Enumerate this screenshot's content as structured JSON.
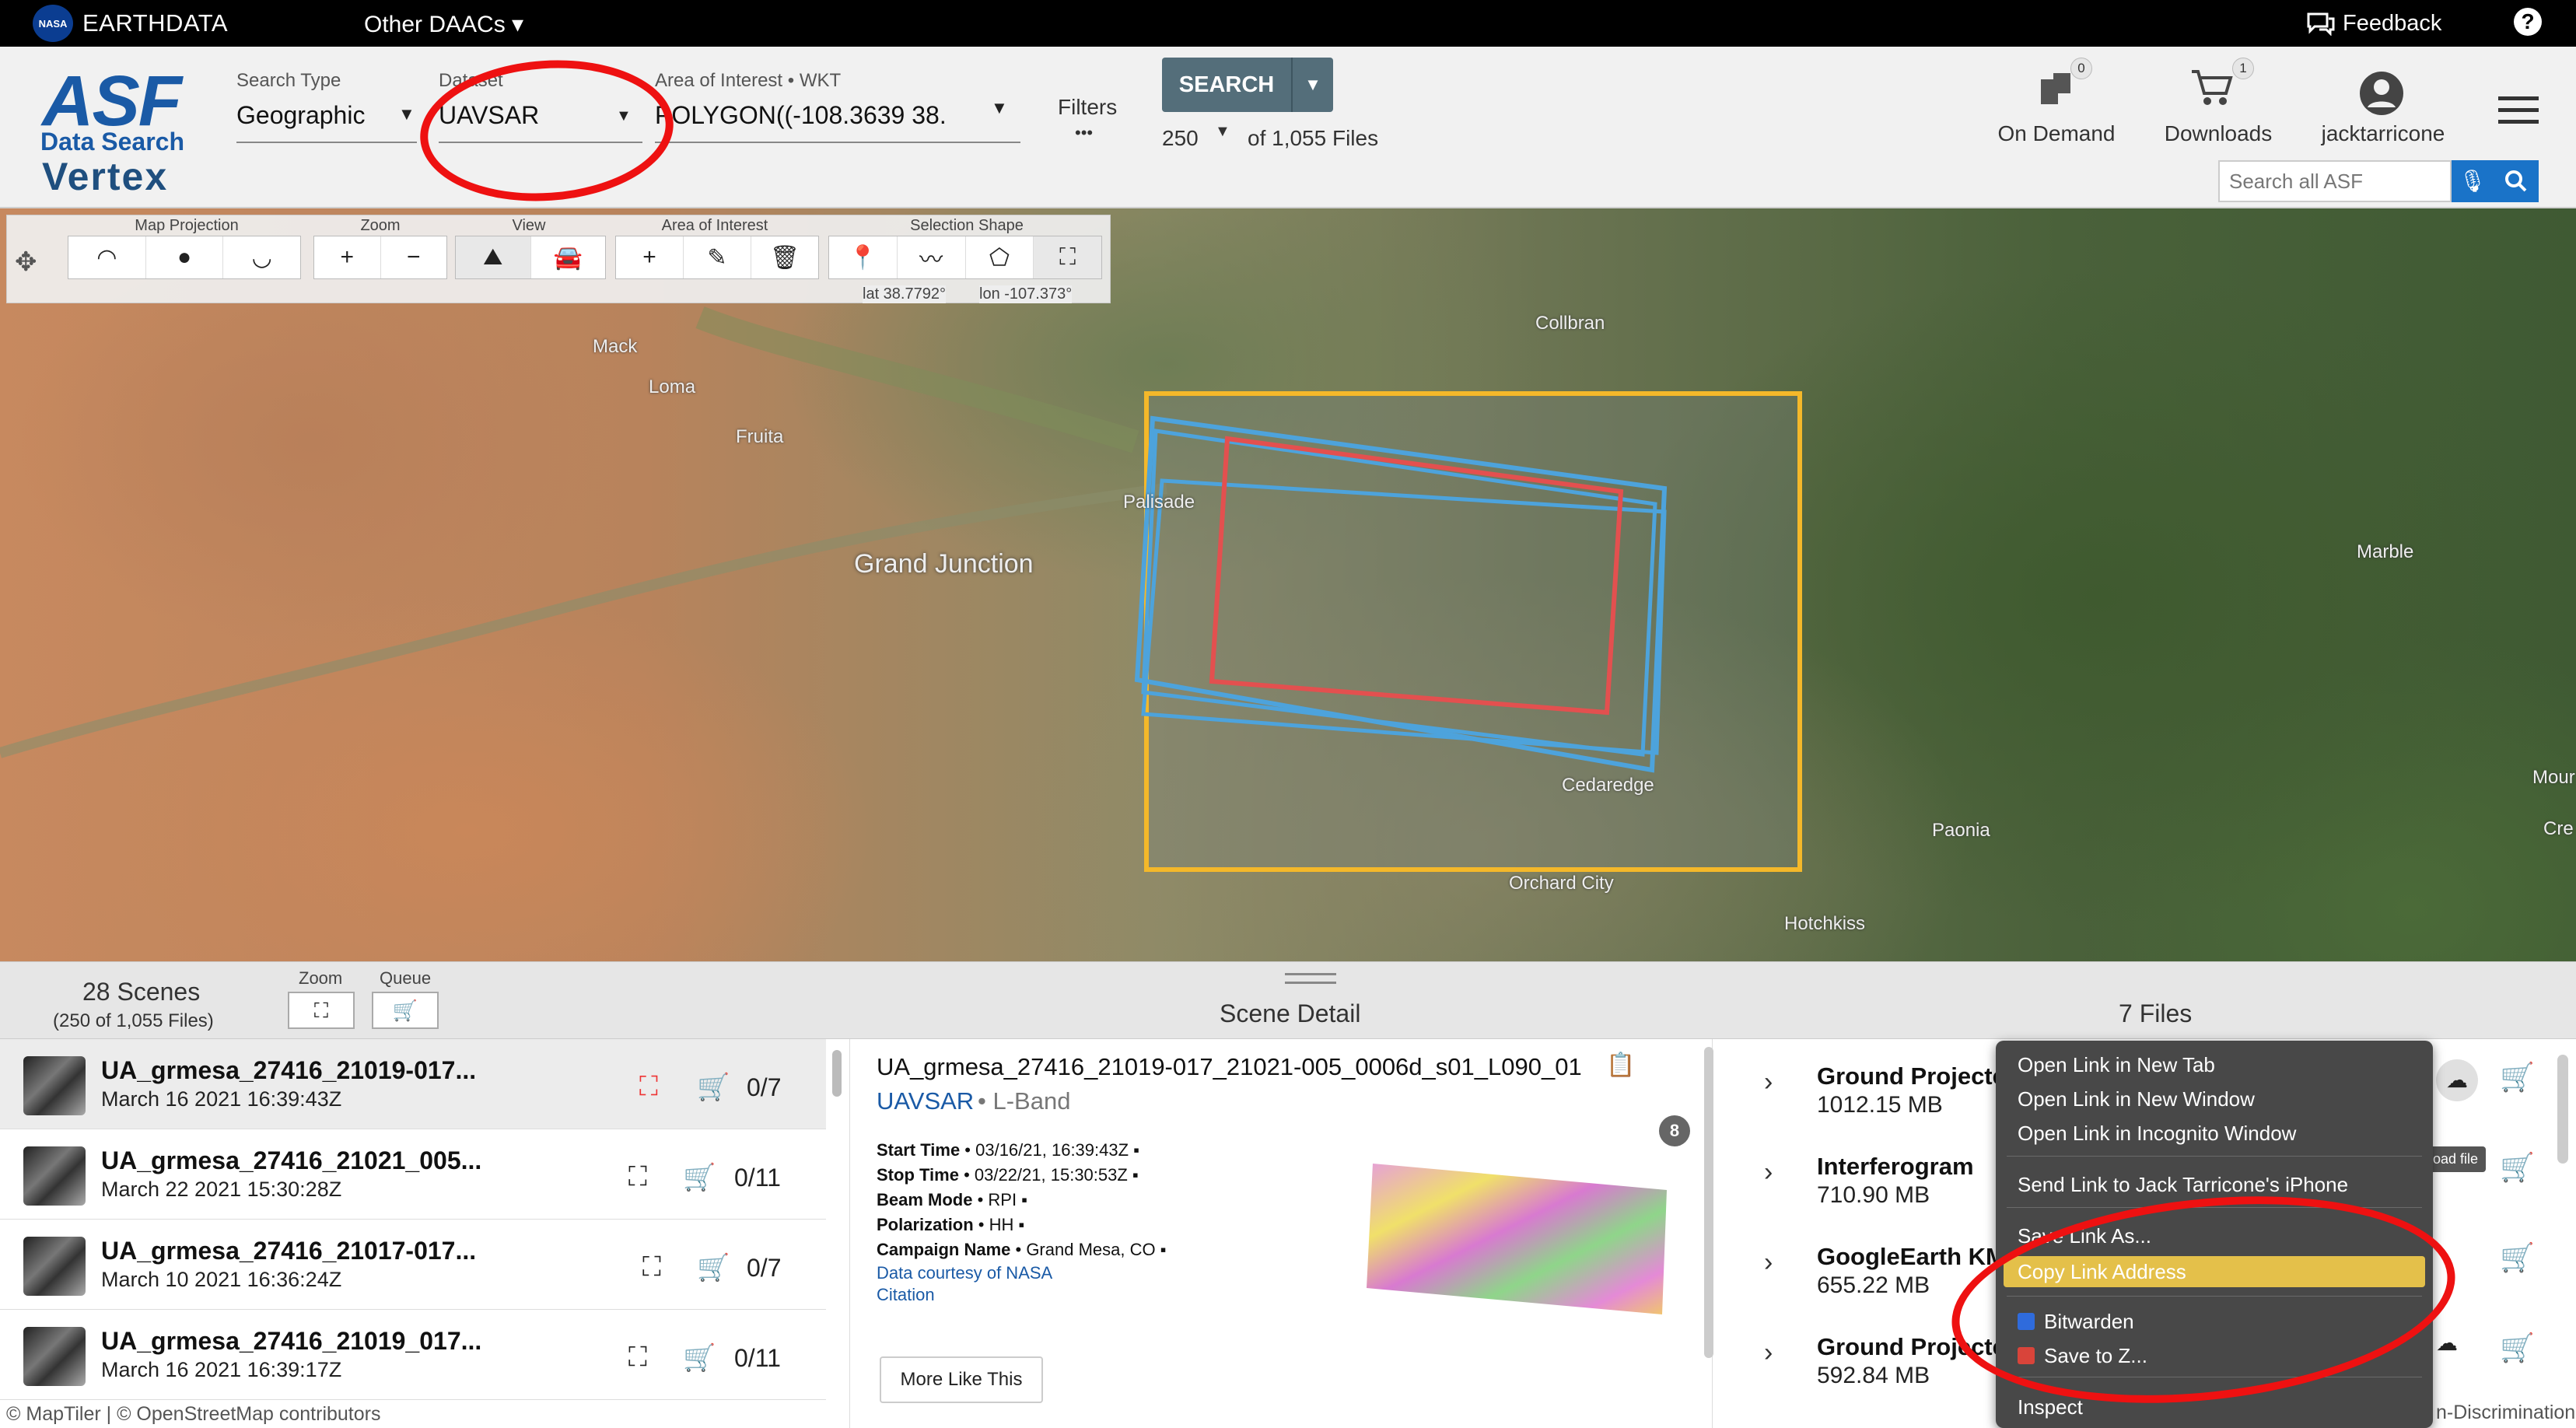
{
  "topbar": {
    "nasa": "NASA",
    "brand": "EARTHDATA",
    "other_daacs": "Other DAACs ▾",
    "feedback": "Feedback",
    "help": "?"
  },
  "header": {
    "logo_asf": "ASF",
    "logo_data_search": "Data Search",
    "logo_vertex": "Vertex",
    "search_type_label": "Search Type",
    "search_type_value": "Geographic",
    "dataset_label": "Dataset",
    "dataset_value": "UAVSAR",
    "aoi_label": "Area of Interest • WKT",
    "aoi_value": "POLYGON((-108.3639 38.",
    "filters_label": "Filters",
    "filters_dots": "•••",
    "search_button": "SEARCH",
    "max_results": "250",
    "of_files": "of 1,055 Files",
    "on_demand_label": "On Demand",
    "on_demand_count": "0",
    "downloads_label": "Downloads",
    "downloads_count": "1",
    "user_label": "jacktarricone",
    "search_all_placeholder": "Search all ASF"
  },
  "toolbar": {
    "map_projection": "Map Projection",
    "zoom": "Zoom",
    "view": "View",
    "area_of_interest": "Area of Interest",
    "selection_shape": "Selection Shape",
    "lat": "lat 38.7792°",
    "lon": "lon -107.373°"
  },
  "map": {
    "towns": [
      "Mack",
      "Loma",
      "Fruita",
      "Grand Junction",
      "Palisade",
      "Collbran",
      "Cedaredge",
      "Orchard City",
      "Hotchkiss",
      "Paonia",
      "Marble",
      "Mour",
      "Cre"
    ],
    "attribution": "© MapTiler | © OpenStreetMap contributors"
  },
  "results": {
    "scenes_title": "28 Scenes",
    "scenes_sub": "(250 of 1,055 Files)",
    "zoom_label": "Zoom",
    "queue_label": "Queue",
    "rows": [
      {
        "name": "UA_grmesa_27416_21019-017...",
        "date": "March 16 2021 16:39:43Z",
        "count": "0/7"
      },
      {
        "name": "UA_grmesa_27416_21021_005...",
        "date": "March 22 2021 15:30:28Z",
        "count": "0/11"
      },
      {
        "name": "UA_grmesa_27416_21017-017...",
        "date": "March 10 2021 16:36:24Z",
        "count": "0/7"
      },
      {
        "name": "UA_grmesa_27416_21019_017...",
        "date": "March 16 2021 16:39:17Z",
        "count": "0/11"
      }
    ]
  },
  "detail": {
    "title": "Scene Detail",
    "scene_name": "UA_grmesa_27416_21019-017_21021-005_0006d_s01_L090_01",
    "platform": "UAVSAR",
    "band": " • L-Band",
    "start_time_k": "Start Time",
    "start_time_v": " • 03/16/21, 16:39:43Z",
    "stop_time_k": "Stop Time",
    "stop_time_v": " • 03/22/21, 15:30:53Z",
    "beam_mode_k": "Beam Mode",
    "beam_mode_v": " • RPI",
    "polarization_k": "Polarization",
    "polarization_v": " • HH",
    "campaign_k": "Campaign Name",
    "campaign_v": " • Grand Mesa, CO",
    "courtesy": "Data courtesy of NASA",
    "citation": "Citation",
    "more_like_this": "More Like This",
    "badge": "8"
  },
  "files": {
    "title": "7 Files",
    "rows": [
      {
        "name": "Ground Projecte",
        "size": "1012.15 MB"
      },
      {
        "name": "Interferogram",
        "size": "710.90 MB"
      },
      {
        "name": "GoogleEarth KM",
        "size": "655.22 MB"
      },
      {
        "name": "Ground Projecte",
        "size": "592.84 MB"
      }
    ],
    "tooltip": "load file",
    "footer_right": "n-Discrimination"
  },
  "context_menu": {
    "items": [
      "Open Link in New Tab",
      "Open Link in New Window",
      "Open Link in Incognito Window",
      "Send Link to Jack Tarricone's iPhone",
      "Save Link As...",
      "Copy Link Address",
      "Bitwarden",
      "Save to Z...",
      "Inspect"
    ]
  },
  "colors": {
    "brand_blue": "#1a5aa6",
    "search_button": "#546e7a",
    "aoi_box": "#f4b82a",
    "scene_red": "#e3504f",
    "scene_blue": "#4da3dc",
    "annotation_red": "#e11111",
    "menu_highlight": "#e4c04a"
  }
}
